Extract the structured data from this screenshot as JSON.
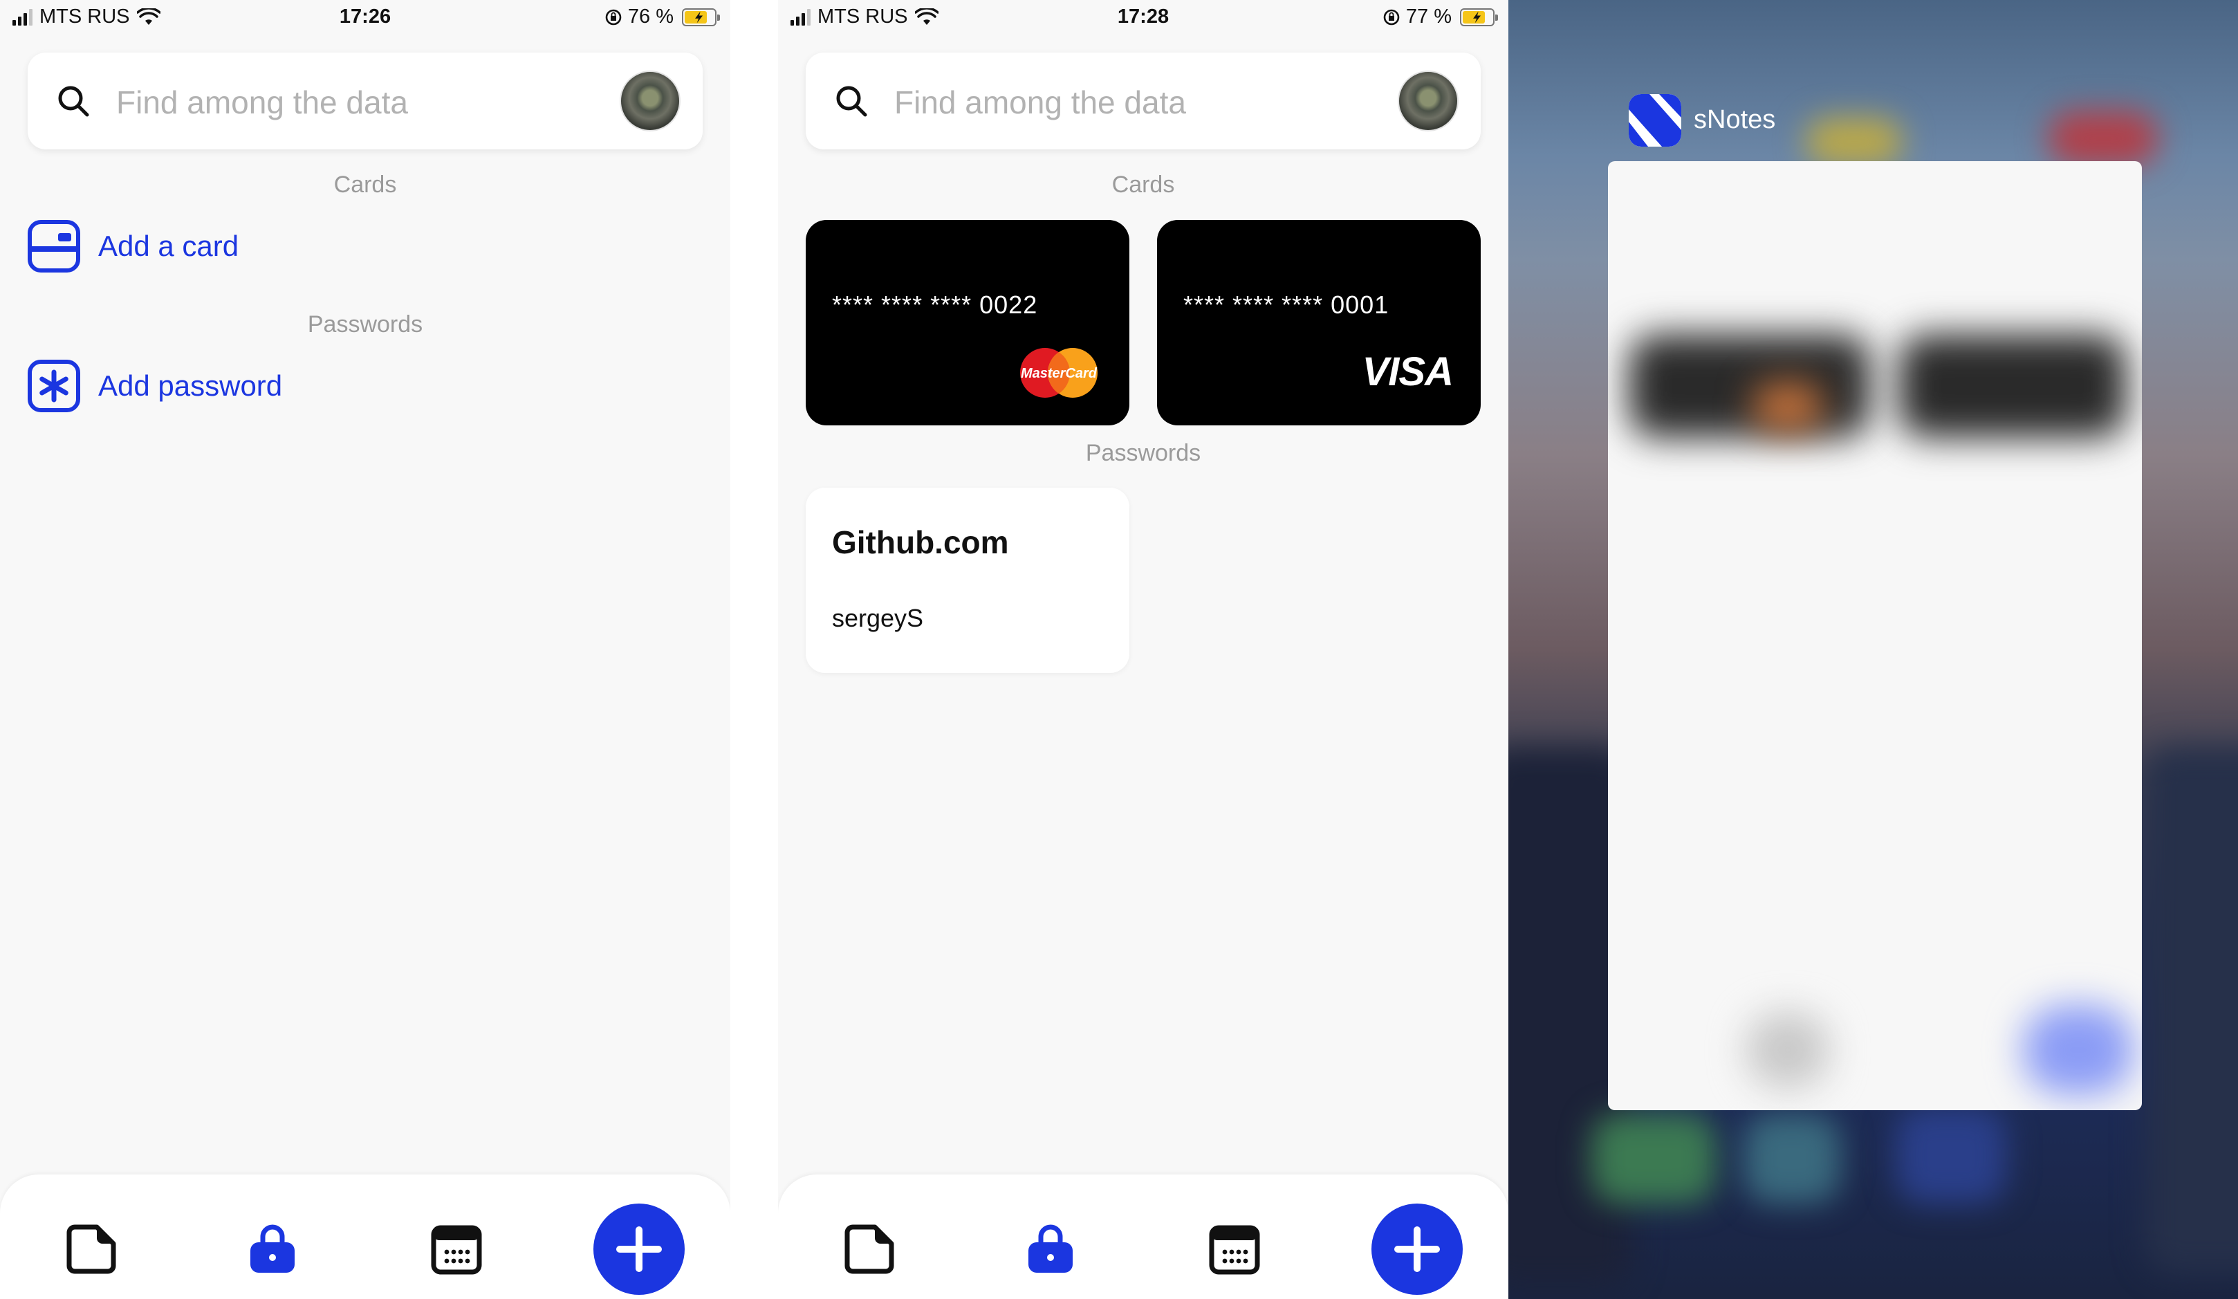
{
  "colors": {
    "accent": "#1b36e0",
    "screen_background": "#f8f8f8",
    "card_background": "#000000",
    "section_title": "#9a9a9a",
    "placeholder": "#b2b2b2"
  },
  "screens": [
    {
      "status": {
        "carrier": "MTS RUS",
        "time": "17:26",
        "battery": "76 %",
        "battery_level": 0.76
      },
      "search": {
        "placeholder": "Find among the data"
      },
      "cards_title": "Cards",
      "add_card_label": "Add a card",
      "passwords_title": "Passwords",
      "add_password_label": "Add password",
      "tabs": [
        "notes-icon",
        "vault-icon",
        "calendar-icon",
        "plus-icon"
      ]
    },
    {
      "status": {
        "carrier": "MTS RUS",
        "time": "17:28",
        "battery": "77 %",
        "battery_level": 0.77
      },
      "search": {
        "placeholder": "Find among the data"
      },
      "cards_title": "Cards",
      "cards": [
        {
          "number": "**** **** **** 0022",
          "brand": "MasterCard"
        },
        {
          "number": "**** **** **** 0001",
          "brand": "VISA"
        }
      ],
      "passwords_title": "Passwords",
      "passwords": [
        {
          "site": "Github.com",
          "username": "sergeyS"
        }
      ],
      "tabs": [
        "notes-icon",
        "vault-icon",
        "calendar-icon",
        "plus-icon"
      ]
    }
  ],
  "switcher": {
    "app_name": "sNotes",
    "app_icon": "snotes-logo-icon"
  }
}
